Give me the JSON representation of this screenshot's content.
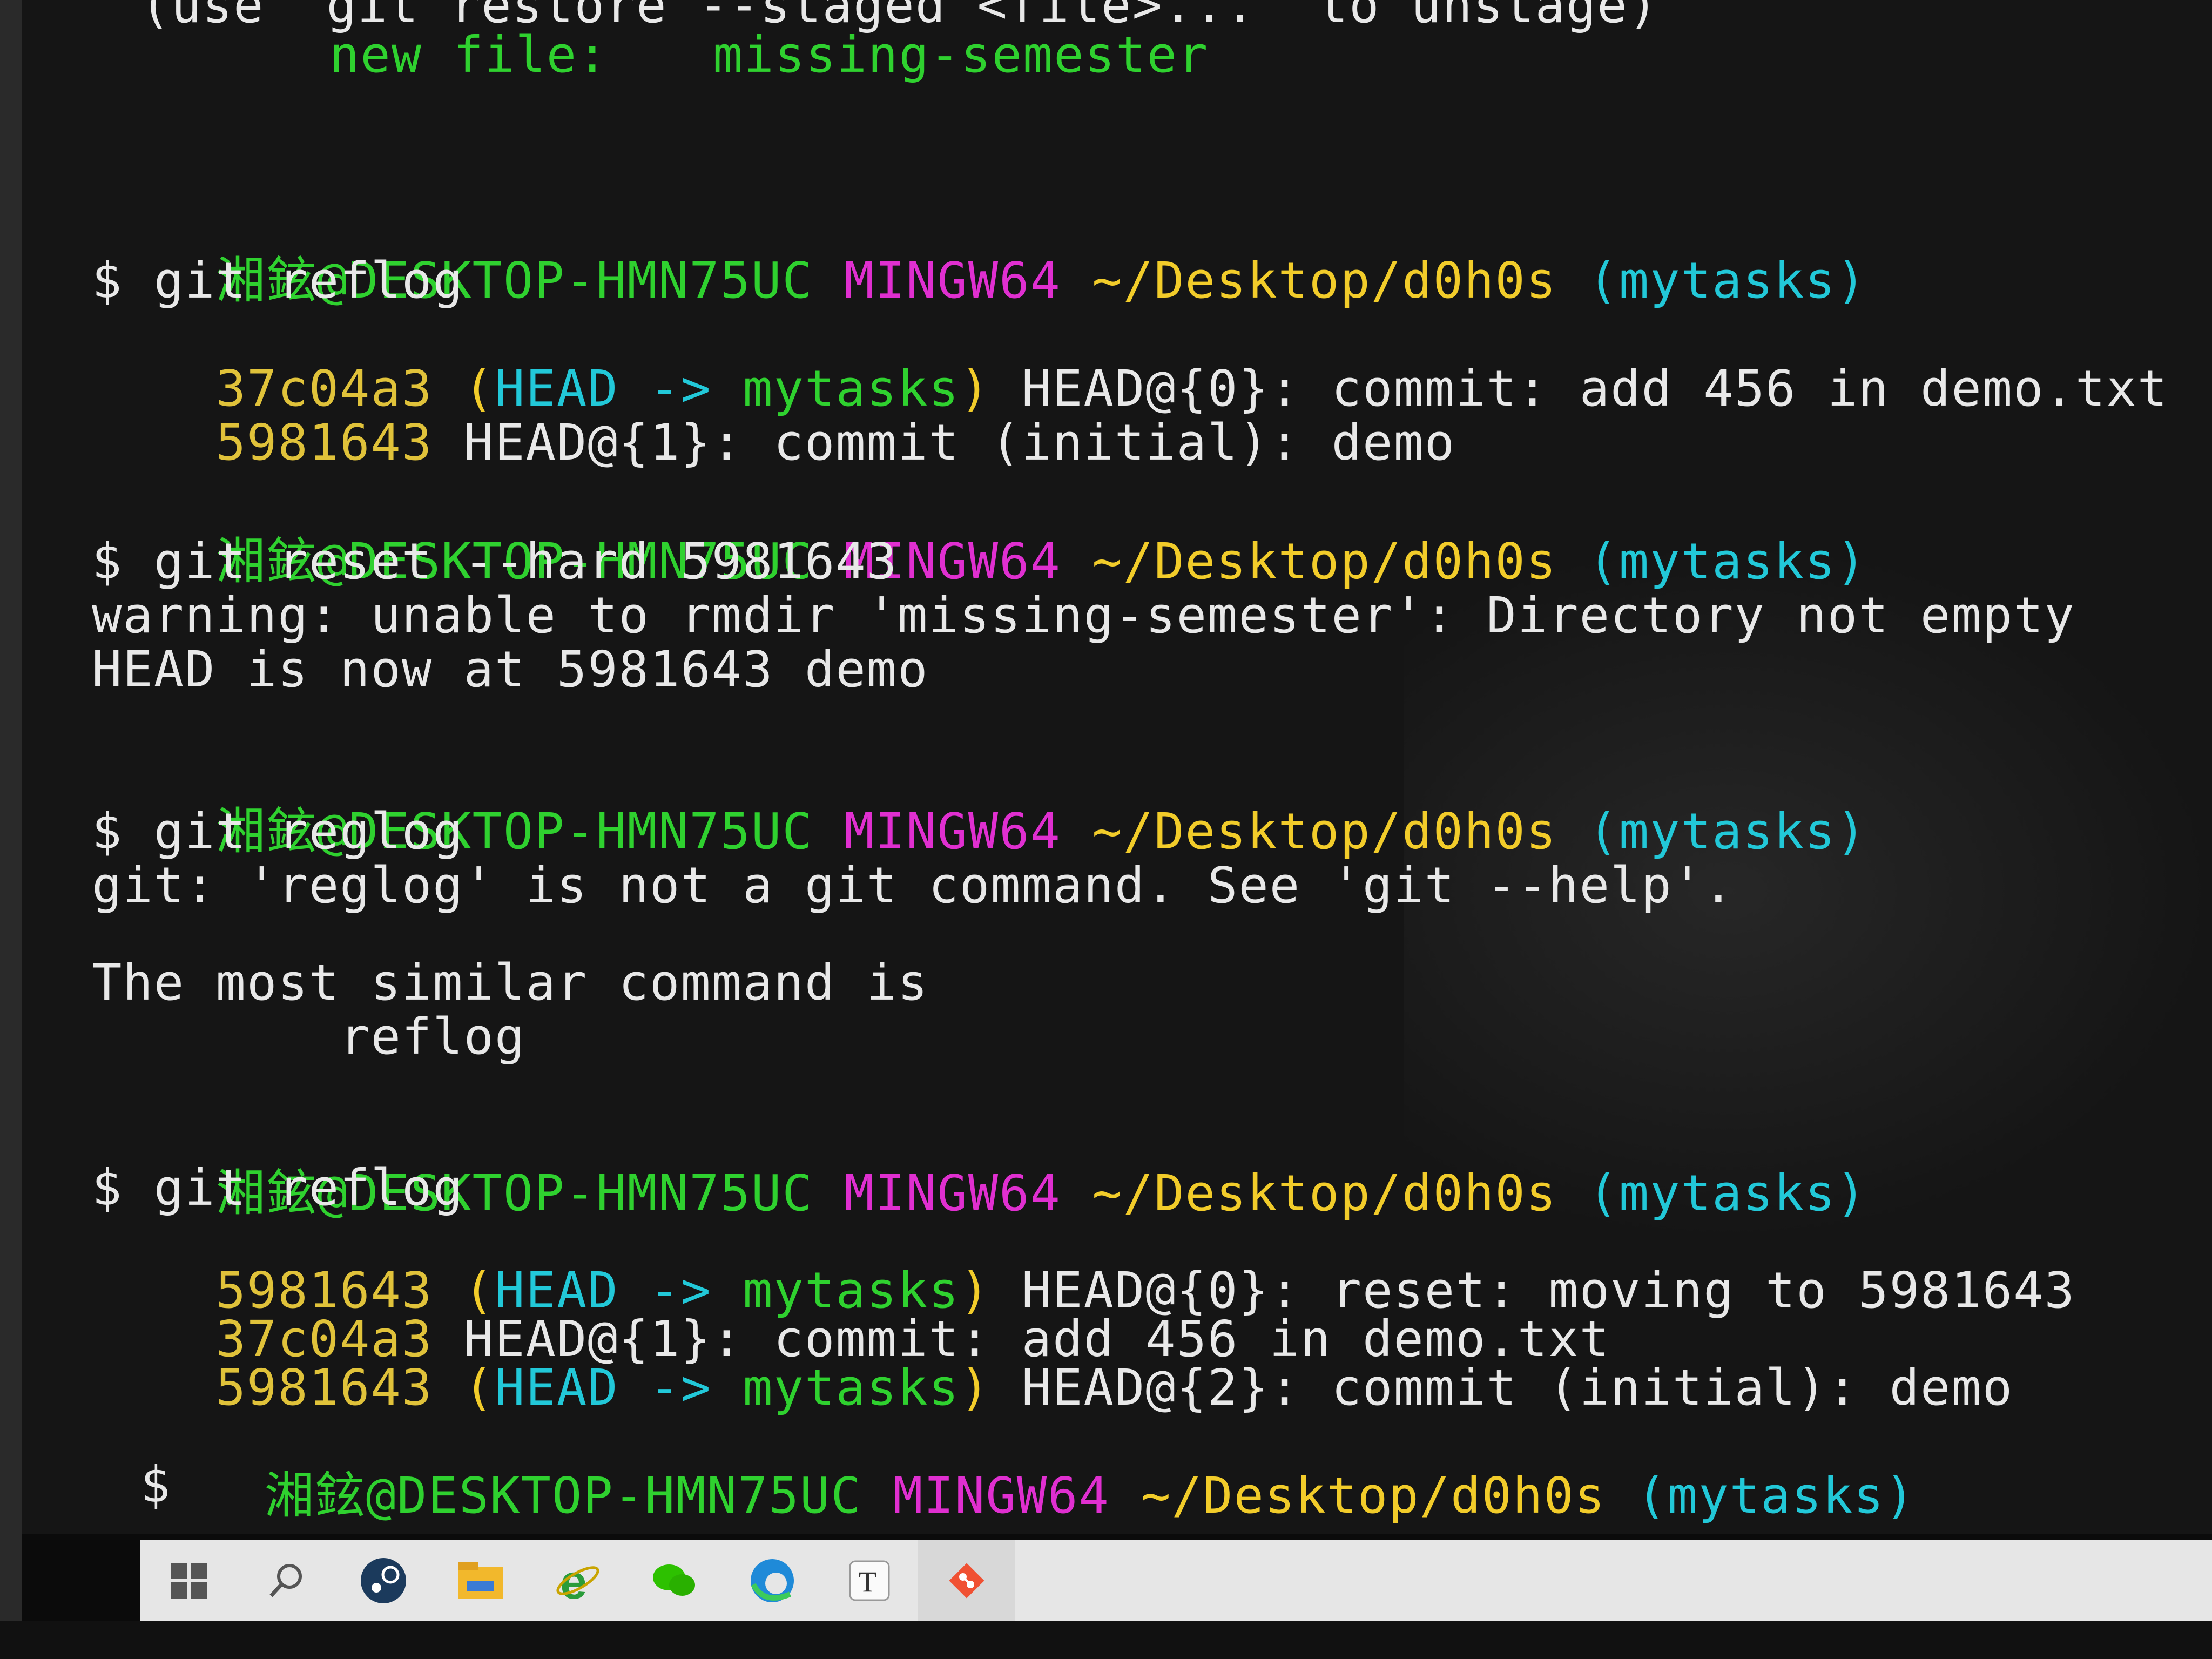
{
  "terminal": {
    "status_header": {
      "hint": "(use \"git restore --staged <file>...\" to unstage)",
      "label": "new file:",
      "path": "missing-semester"
    },
    "prompts": [
      {
        "user": "湘鉉@DESKTOP-HMN75UC",
        "env": "MINGW64",
        "path": "~/Desktop/d0h0s",
        "branch": "(mytasks)",
        "command": "$ git reflog"
      },
      {
        "user": "湘鉉@DESKTOP-HMN75UC",
        "env": "MINGW64",
        "path": "~/Desktop/d0h0s",
        "branch": "(mytasks)",
        "command": "$ git reset --hard 5981643"
      },
      {
        "user": "湘鉉@DESKTOP-HMN75UC",
        "env": "MINGW64",
        "path": "~/Desktop/d0h0s",
        "branch": "(mytasks)",
        "command": "$ git reglog"
      },
      {
        "user": "湘鉉@DESKTOP-HMN75UC",
        "env": "MINGW64",
        "path": "~/Desktop/d0h0s",
        "branch": "(mytasks)",
        "command": "$ git reflog"
      },
      {
        "user": "湘鉉@DESKTOP-HMN75UC",
        "env": "MINGW64",
        "path": "~/Desktop/d0h0s",
        "branch": "(mytasks)",
        "command": "$"
      }
    ],
    "reflog1": [
      {
        "hash": "37c04a3",
        "ref_open": "(",
        "head": "HEAD",
        "arrow": "->",
        "branch": "mytasks",
        "ref_close": ")",
        "text": "HEAD@{0}: commit: add 456 in demo.txt"
      },
      {
        "hash": "5981643",
        "text": "HEAD@{1}: commit (initial): demo"
      }
    ],
    "reset_output": [
      "warning: unable to rmdir 'missing-semester': Directory not empty",
      "HEAD is now at 5981643 demo"
    ],
    "reglog_output": [
      "git: 'reglog' is not a git command. See 'git --help'.",
      "The most similar command is",
      "        reflog"
    ],
    "reflog2": [
      {
        "hash": "5981643",
        "ref_open": "(",
        "head": "HEAD",
        "arrow": "->",
        "branch": "mytasks",
        "ref_close": ")",
        "text": "HEAD@{0}: reset: moving to 5981643"
      },
      {
        "hash": "37c04a3",
        "text": "HEAD@{1}: commit: add 456 in demo.txt"
      },
      {
        "hash": "5981643",
        "ref_open": "(",
        "head": "HEAD",
        "arrow": "->",
        "branch": "mytasks",
        "ref_close": ")",
        "text": "HEAD@{2}: commit (initial): demo"
      }
    ]
  },
  "taskbar": {
    "icons": [
      "windows-start-icon",
      "search-icon",
      "steam-icon",
      "file-explorer-icon",
      "internet-explorer-icon",
      "wechat-icon",
      "edge-icon",
      "typora-icon",
      "git-icon"
    ]
  },
  "colors": {
    "prompt_user": "#2fd12f",
    "prompt_env": "#e02fd0",
    "prompt_path": "#f2cc2a",
    "prompt_branch": "#22c8d8",
    "text": "#e8e8e8",
    "hash": "#e0c23a"
  }
}
